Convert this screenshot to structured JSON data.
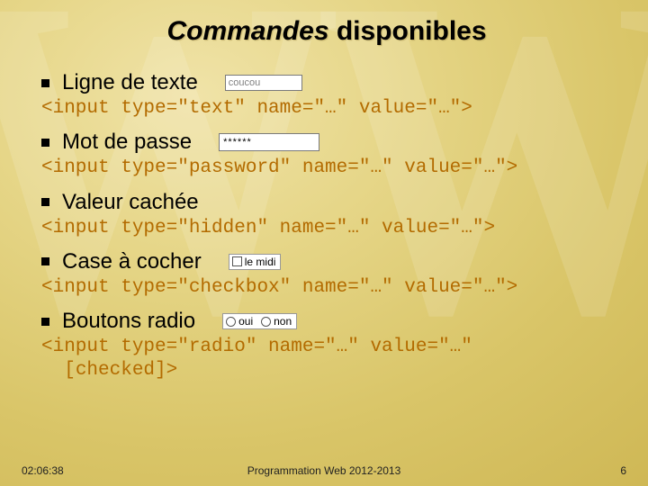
{
  "title": {
    "em": "Commandes",
    "rest": " disponibles"
  },
  "items": [
    {
      "label": "Ligne de texte",
      "demo": {
        "kind": "text",
        "value": "coucou"
      },
      "code": "<input type=\"text\" name=\"…\" value=\"…\">"
    },
    {
      "label": "Mot de passe",
      "demo": {
        "kind": "password",
        "value": "******"
      },
      "code": "<input type=\"password\" name=\"…\" value=\"…\">"
    },
    {
      "label": "Valeur cachée",
      "demo": null,
      "code": "<input type=\"hidden\" name=\"…\" value=\"…\">"
    },
    {
      "label": "Case à cocher",
      "demo": {
        "kind": "checkbox",
        "text": "le midi"
      },
      "code": "<input type=\"checkbox\" name=\"…\" value=\"…\">"
    },
    {
      "label": "Boutons radio",
      "demo": {
        "kind": "radio",
        "opts": [
          "oui",
          "non"
        ]
      },
      "code": "<input type=\"radio\" name=\"…\" value=\"…\"\n  [checked]>"
    }
  ],
  "footer": {
    "time": "02:06:38",
    "course": "Programmation Web 2012-2013",
    "page": "6"
  }
}
